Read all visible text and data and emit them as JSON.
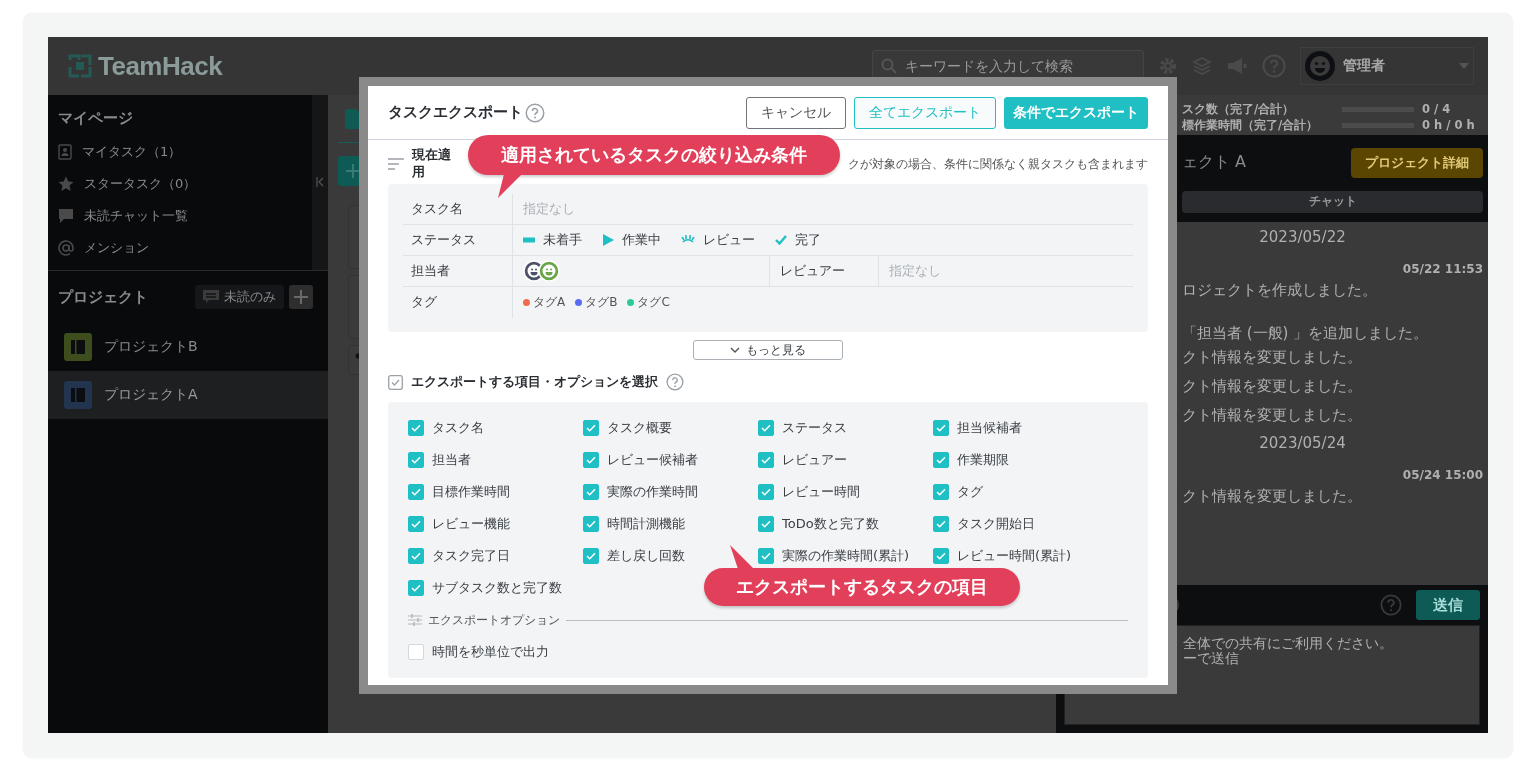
{
  "header": {
    "logo": "TeamHack",
    "search_placeholder": "キーワードを入力して検索",
    "user": "管理者"
  },
  "sidebar": {
    "mypage_title": "マイページ",
    "mypage_items": [
      {
        "kind": "task",
        "label": "マイタスク（1）"
      },
      {
        "kind": "star",
        "label": "スタータスク（0）"
      },
      {
        "kind": "chat",
        "label": "未読チャット一覧"
      },
      {
        "kind": "mention",
        "label": "メンション"
      }
    ],
    "projects_title": "プロジェクト",
    "unread_button": "未読のみ",
    "projects": [
      {
        "name": "プロジェクトB",
        "color": "#3d4d1c",
        "selected": false
      },
      {
        "name": "プロジェクトA",
        "color": "#22344e",
        "selected": true
      }
    ]
  },
  "right_panel": {
    "stats": [
      {
        "label": "スク数（完了/合計）",
        "value": "0 / 4",
        "level": 0
      },
      {
        "label": "標作業時間（完了/合計）",
        "value": "0 h / 0 h",
        "level": 0
      }
    ],
    "project_name": "ェクト A",
    "detail_button": "プロジェクト詳細",
    "tab": "チャット",
    "chat": [
      {
        "kind": "date",
        "text": "2023/05/22"
      },
      {
        "kind": "time",
        "text": "05/22 11:53"
      },
      {
        "kind": "message",
        "text": "ロジェクトを作成しました。"
      },
      {
        "kind": "message",
        "text": "「担当者 (一般) 」を追加しました。"
      },
      {
        "kind": "message",
        "text": "クト情報を変更しました。"
      },
      {
        "kind": "message",
        "text": "クト情報を変更しました。"
      },
      {
        "kind": "message",
        "text": "クト情報を変更しました。"
      },
      {
        "kind": "date",
        "text": "2023/05/24"
      },
      {
        "kind": "time",
        "text": "05/24 15:00"
      },
      {
        "kind": "message",
        "text": "クト情報を変更しました。"
      }
    ],
    "send_button": "送信",
    "input_lines": [
      "全体での共有にご利用ください。",
      "ーで送信"
    ]
  },
  "modal": {
    "title": "タスクエクスポート",
    "buttons": [
      {
        "label": "キャンセル",
        "kind": "secondary"
      },
      {
        "label": "全てエクスポート",
        "kind": "outline"
      },
      {
        "label": "条件でエクスポート",
        "kind": "primary"
      }
    ],
    "filter_heading_start": "現在適用",
    "filter_heading_end": "クが対象の場合、条件に関係なく親タスクも含まれます",
    "filter_rows": [
      {
        "kind": "text",
        "label": "タスク名",
        "value": "指定なし",
        "muted": true
      },
      {
        "kind": "status",
        "label": "ステータス",
        "statuses": [
          {
            "kind": "todo",
            "label": "未着手"
          },
          {
            "kind": "doing",
            "label": "作業中"
          },
          {
            "kind": "review",
            "label": "レビュー"
          },
          {
            "kind": "done",
            "label": "完了"
          }
        ]
      },
      {
        "kind": "people",
        "label": "担当者",
        "assignees": [
          {
            "color": "#4b5166"
          },
          {
            "color": "#69a64a"
          }
        ],
        "sub_label": "レビュアー",
        "sub_value": "指定なし",
        "sub_muted": true
      },
      {
        "kind": "tags",
        "label": "タグ",
        "tags": [
          {
            "label": "タグA",
            "color": "#f26b4a"
          },
          {
            "label": "タグB",
            "color": "#5a6cf0"
          },
          {
            "label": "タグC",
            "color": "#2ec99a"
          }
        ]
      }
    ],
    "more_button": "もっと見る",
    "items_heading": "エクスポートする項目・オプションを選択",
    "items": [
      {
        "label": "タスク名",
        "checked": true
      },
      {
        "label": "タスク概要",
        "checked": true
      },
      {
        "label": "ステータス",
        "checked": true
      },
      {
        "label": "担当候補者",
        "checked": true
      },
      {
        "label": "担当者",
        "checked": true
      },
      {
        "label": "レビュー候補者",
        "checked": true
      },
      {
        "label": "レビュアー",
        "checked": true
      },
      {
        "label": "作業期限",
        "checked": true
      },
      {
        "label": "目標作業時間",
        "checked": true
      },
      {
        "label": "実際の作業時間",
        "checked": true
      },
      {
        "label": "レビュー時間",
        "checked": true
      },
      {
        "label": "タグ",
        "checked": true
      },
      {
        "label": "レビュー機能",
        "checked": true
      },
      {
        "label": "時間計測機能",
        "checked": true
      },
      {
        "label": "ToDo数と完了数",
        "checked": true
      },
      {
        "label": "タスク開始日",
        "checked": true
      },
      {
        "label": "タスク完了日",
        "checked": true
      },
      {
        "label": "差し戻し回数",
        "checked": true
      },
      {
        "label": "実際の作業時間(累計)",
        "checked": true
      },
      {
        "label": "レビュー時間(累計)",
        "checked": true
      },
      {
        "label": "サブタスク数と完了数",
        "checked": true
      }
    ],
    "options_heading": "エクスポートオプション",
    "options": [
      {
        "label": "時間を秒単位で出力",
        "checked": false
      }
    ]
  },
  "callouts": [
    {
      "text": "適用されているタスクの絞り込み条件"
    },
    {
      "text": "エクスポートするタスクの項目"
    }
  ]
}
